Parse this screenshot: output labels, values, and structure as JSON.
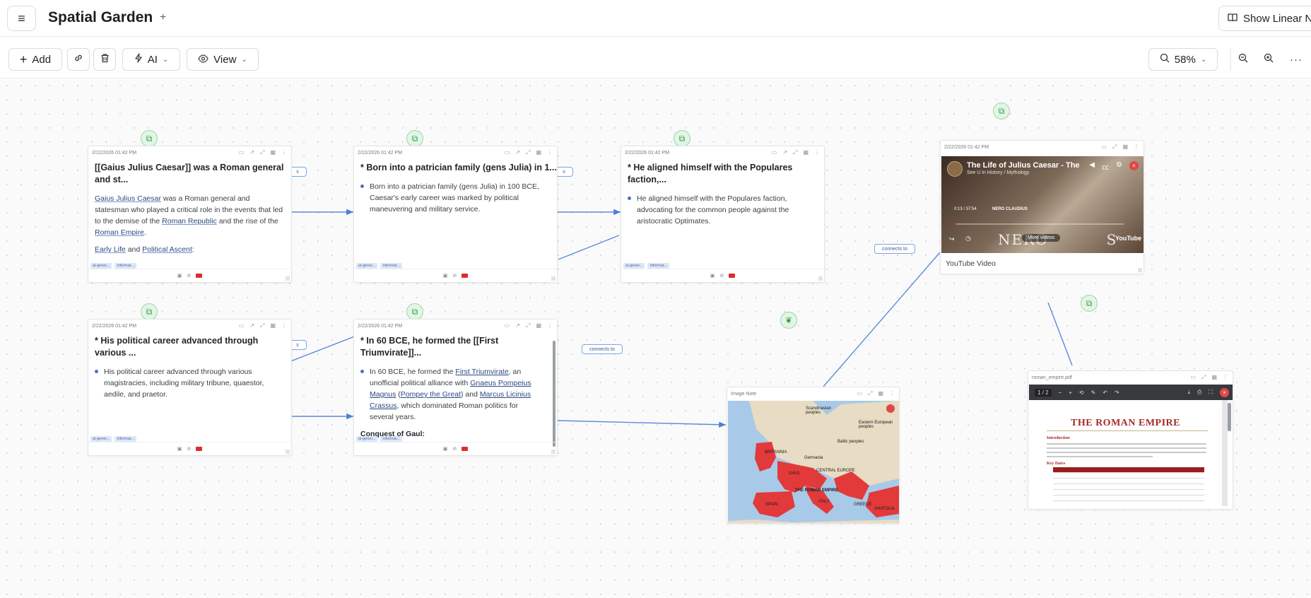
{
  "app": {
    "title": "Spatial Garden",
    "title_add": "+",
    "menu_icon": "≡",
    "linear_button": "Show Linear N"
  },
  "toolbar": {
    "add_label": "Add",
    "ai_label": "AI",
    "view_label": "View",
    "zoom_label": "58%"
  },
  "edges": {
    "connects_to": "connects to",
    "partial": "s"
  },
  "cards": [
    {
      "timestamp": "2/22/2026 01:42 PM",
      "title": "[[Gaius Julius Caesar]] was a Roman general and st...",
      "body": {
        "t0": "Gaius Julius Caesar",
        "t1": " was a Roman general and statesman who played a critical role in the events that led to the demise of the ",
        "t2": "Roman Republic",
        "t3": " and the rise of the ",
        "t4": "Roman Empire",
        "t5": ".",
        "t6": "Early Life",
        "t7": " and ",
        "t8": "Political Ascent",
        "t9": ":"
      },
      "tags": [
        "ai-gener...",
        "informat..."
      ]
    },
    {
      "timestamp": "2/22/2026 01:42 PM",
      "title": "* Born into a patrician family (gens Julia) in 1...",
      "bullet": "Born into a patrician family (gens Julia) in 100 BCE, Caesar's early career was marked by political maneuvering and military service.",
      "tags": [
        "ai-gener...",
        "informat..."
      ]
    },
    {
      "timestamp": "2/22/2026 01:42 PM",
      "title": "* He aligned himself with the Populares faction,...",
      "bullet": "He aligned himself with the Populares faction, advocating for the common people against the aristocratic Optimates.",
      "tags": [
        "ai-gener...",
        "informat..."
      ]
    },
    {
      "timestamp": "2/22/2026 01:42 PM",
      "title": "* His political career advanced through various ...",
      "bullet": "His political career advanced through various magistracies, including military tribune, quaestor, aedile, and praetor.",
      "tags": [
        "ai-gener...",
        "informat..."
      ]
    },
    {
      "timestamp": "2/22/2026 01:42 PM",
      "title": "* In 60 BCE, he formed the [[First Triumvirate]]...",
      "body": {
        "b0": "In 60 BCE, he formed the ",
        "b1": "First Triumvirate",
        "b2": ", an unofficial political alliance with ",
        "b3": "Gnaeus Pompeius Magnus",
        "b4": " (",
        "b5": "Pompey the Great",
        "b6": ") and ",
        "b7": "Marcus Licinius Crassus",
        "b8": ", which dominated Roman politics for several years.",
        "subhead": "Conquest of Gaul:"
      },
      "tags": [
        "ai-gener...",
        "informat..."
      ]
    }
  ],
  "youtube": {
    "timestamp": "2/22/2026 01:42 PM",
    "video_title": "The Life of Julius Caesar - The",
    "channel": "See U in History / Mythology",
    "time": "0:13 / 37:54",
    "chapter": "NERO CLAUDIUS",
    "overlay_text": "NERO",
    "overlay_text_2": "S",
    "more_videos": "More videos",
    "logo": "YouTube",
    "caption": "YouTube Video",
    "progress": 0.01
  },
  "map": {
    "label": "Image Note",
    "labels": {
      "empire": "THE ROMAN EMPIRE",
      "central_europe": "CENTRAL EUROPE",
      "gaul": "GAUL",
      "spain": "SPAIN",
      "italy": "ITALY",
      "greece": "GREECE",
      "britannia": "BRITANNIA",
      "germania": "Germania",
      "anatolia": "ANATOLIA",
      "scandinavia": "Scandinavian peoples",
      "eastern": "Eastern European peoples",
      "baltic": "Baltic peoples"
    }
  },
  "pdf": {
    "filename": "roman_empire.pdf",
    "page_indicator": "1 / 2",
    "heading": "THE ROMAN EMPIRE",
    "subheading": "Introduction",
    "subheading_2": "Key Dates"
  }
}
